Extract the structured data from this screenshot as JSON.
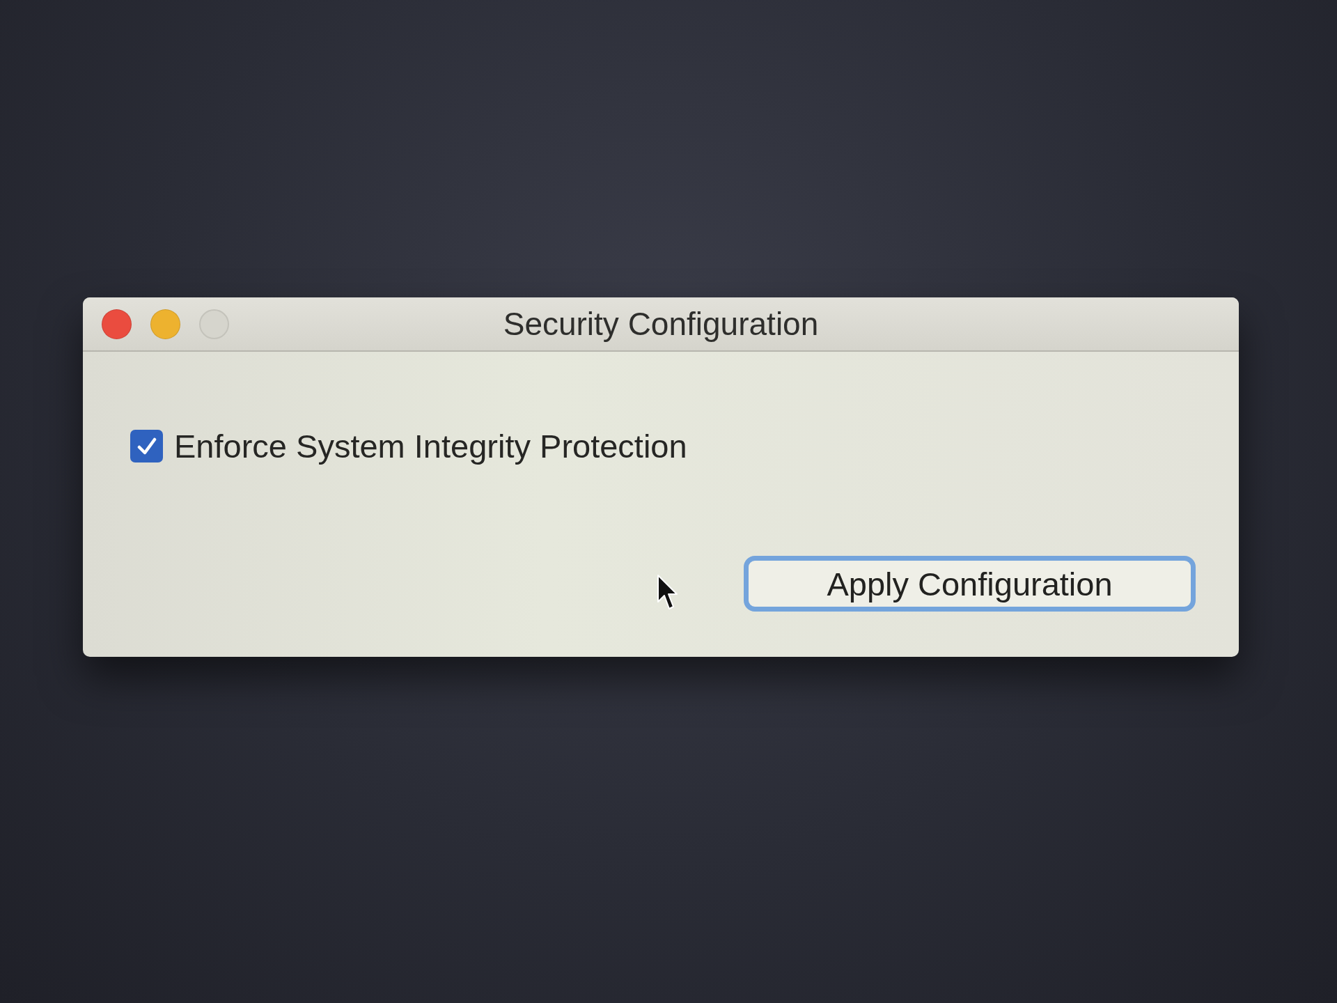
{
  "window": {
    "title": "Security Configuration",
    "controls": [
      {
        "kind": "close",
        "disabled": false
      },
      {
        "kind": "minimize",
        "disabled": false
      },
      {
        "kind": "zoom",
        "disabled": true
      }
    ]
  },
  "checkbox": {
    "label": "Enforce System Integrity Protection",
    "checked": true
  },
  "button": {
    "label": "Apply Configuration",
    "focused": true
  }
}
